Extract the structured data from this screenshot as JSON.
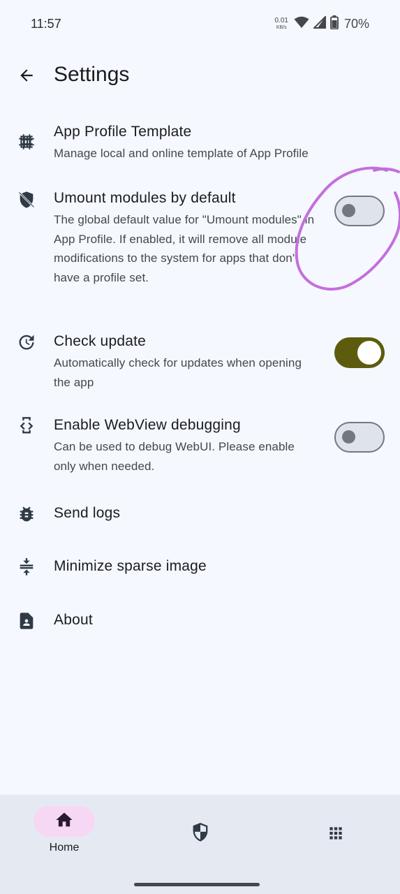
{
  "status_bar": {
    "time": "11:57",
    "net_speed": "0.01",
    "net_unit": "KB/s",
    "battery": "70%"
  },
  "header": {
    "title": "Settings"
  },
  "settings": [
    {
      "title": "App Profile Template",
      "desc": "Manage local and online template of App Profile",
      "icon": "grid-template-icon"
    },
    {
      "title": "Umount modules by default",
      "desc": "The global default value for \"Umount modules\" in App Profile. If enabled, it will remove all module modifications to the system for apps that don't have a profile set.",
      "icon": "shield-off-icon",
      "switch": "off"
    },
    {
      "title": "Check update",
      "desc": "Automatically check for updates when opening the app",
      "icon": "update-icon",
      "switch": "on"
    },
    {
      "title": "Enable WebView debugging",
      "desc": "Can be used to debug WebUI. Please enable only when needed.",
      "icon": "developer-mode-icon",
      "switch": "off"
    },
    {
      "title": "Send logs",
      "icon": "bug-icon"
    },
    {
      "title": "Minimize sparse image",
      "icon": "compress-icon"
    },
    {
      "title": "About",
      "icon": "contact-page-icon"
    }
  ],
  "bottom_nav": {
    "items": [
      {
        "label": "Home",
        "icon": "home-icon",
        "selected": true
      },
      {
        "label": "",
        "icon": "superuser-shield-icon",
        "selected": false
      },
      {
        "label": "",
        "icon": "apps-grid-icon",
        "selected": false
      }
    ]
  },
  "colors": {
    "background": "#f5f8ff",
    "switch_on": "#5d5c0e",
    "nav_selected_pill": "#f6d8f5",
    "annotation": "#c46fdc"
  }
}
